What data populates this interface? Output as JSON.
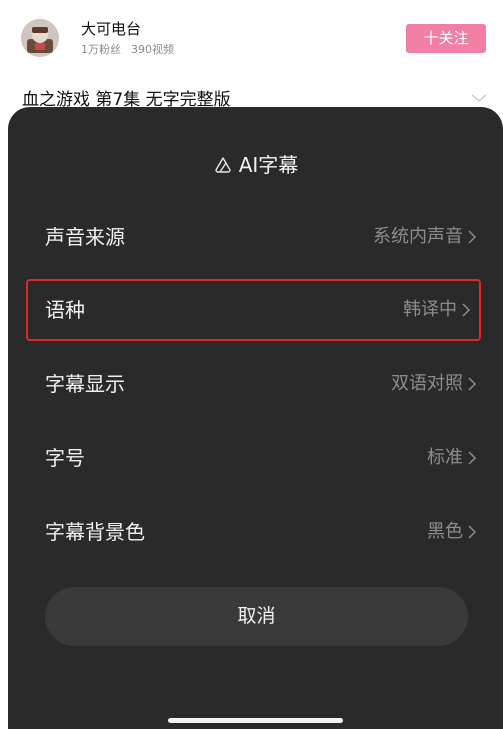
{
  "channel": {
    "name": "大可电台",
    "fans": "1万粉丝",
    "videos": "390视频",
    "follow_label": "十关注"
  },
  "video": {
    "title": "血之游戏 第7集 无字完整版"
  },
  "sheet": {
    "title": "AI字幕",
    "rows": [
      {
        "label": "声音来源",
        "value": "系统内声音"
      },
      {
        "label": "语种",
        "value": "韩译中"
      },
      {
        "label": "字幕显示",
        "value": "双语对照"
      },
      {
        "label": "字号",
        "value": "标准"
      },
      {
        "label": "字幕背景色",
        "value": "黑色"
      }
    ],
    "cancel_label": "取消"
  },
  "colors": {
    "follow_bg": "#f07fa3",
    "sheet_bg": "#2a2a2a",
    "highlight_outline": "#e0252b"
  }
}
